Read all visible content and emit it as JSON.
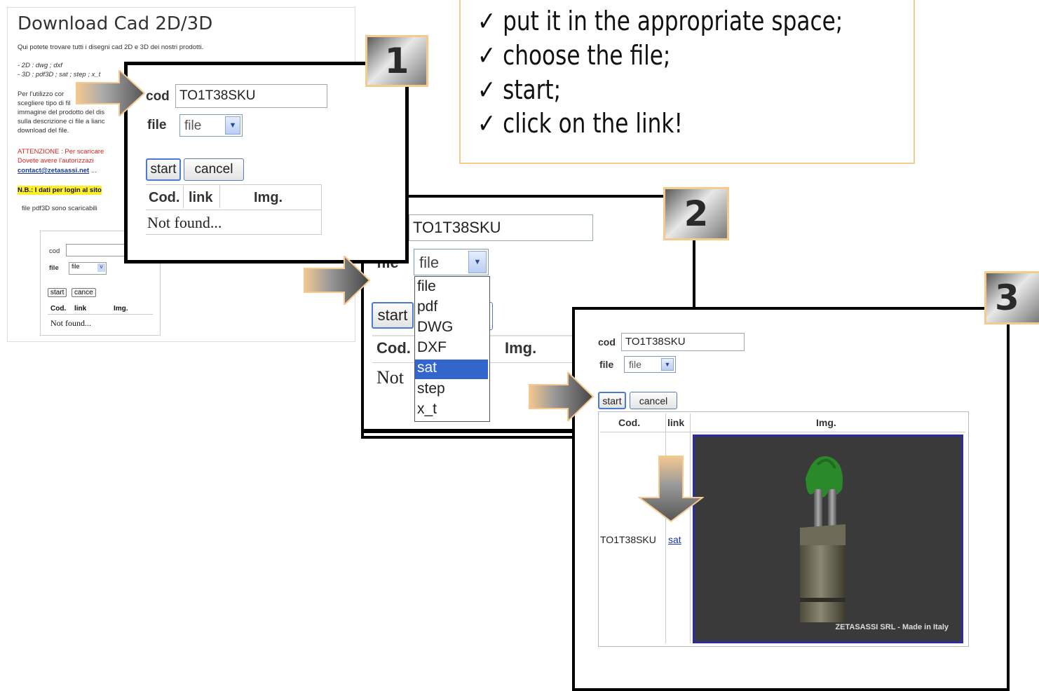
{
  "background_page": {
    "title": "Download Cad 2D/3D",
    "intro": "Qui potete trovare tutti i disegni cad 2D e 3D dei nostri prodotti.",
    "formats_2d": "- 2D :  dwg ; dxf",
    "formats_3d": "- 3D :  pdf3D ; sat ; step ; x_t",
    "para_lines": [
      "Per l'utilizzo cor",
      "scegliere tipo di fil",
      "immagine del prodotto del dis",
      "sulla descrizione ci file a lianc",
      "download del file."
    ],
    "warning_lines": [
      "ATTENZIONE : Per scaricare",
      "Dovete avere l'autorizzazi"
    ],
    "email": "contact@zetasassi.net",
    "email_suffix": "...",
    "note": "N.B.: I dati per login al sito",
    "pdf_note": "file pdf3D sono scaricabili",
    "form": {
      "cod_label": "cod",
      "file_label": "file",
      "file_value": "file",
      "start": "start",
      "cancel": "cance",
      "col_cod": "Cod.",
      "col_link": "link",
      "col_img": "Img.",
      "result": "Not found..."
    }
  },
  "instructions": [
    "put it in the appropriate space;",
    "choose the file;",
    "start;",
    "click on the link!"
  ],
  "step1": {
    "badge": "1",
    "cod_label": "cod",
    "cod_value": "TO1T38SKU",
    "file_label": "file",
    "file_value": "file",
    "start": "start",
    "cancel": "cancel",
    "col_cod": "Cod.",
    "col_link": "link",
    "col_img": "Img.",
    "result": "Not found..."
  },
  "step2": {
    "badge": "2",
    "cod_value": "TO1T38SKU",
    "file_label": "file",
    "file_value": "file",
    "start": "start",
    "col_cod": "Cod.",
    "col_img": "Img.",
    "result": "Not",
    "options": [
      "file",
      "pdf",
      "DWG",
      "DXF",
      "sat",
      "step",
      "x_t"
    ],
    "selected_option": "sat"
  },
  "step3": {
    "badge": "3",
    "cod_label": "cod",
    "cod_value": "TO1T38SKU",
    "file_label": "file",
    "file_value": "file",
    "start": "start",
    "cancel": "cancel",
    "col_cod": "Cod.",
    "col_link": "link",
    "col_img": "Img.",
    "row_cod": "TO1T38SKU",
    "row_link": "sat",
    "image_caption": "ZETASASSI SRL  - Made in Italy"
  },
  "colors": {
    "accent_orange": "#f6c990",
    "selection_blue": "#3366cc",
    "render_bg": "#3a3a3a"
  }
}
